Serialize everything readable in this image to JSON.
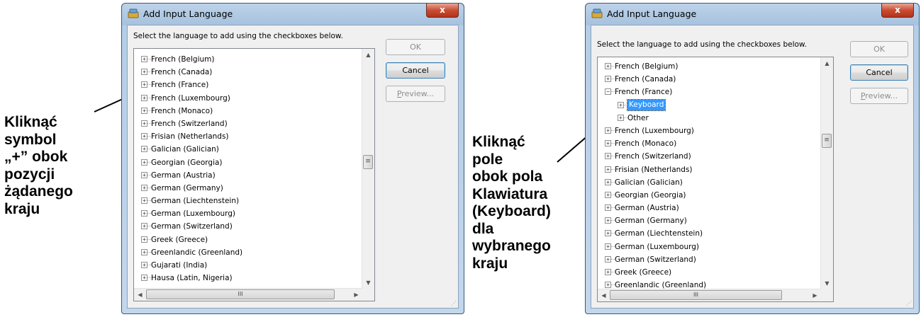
{
  "annotations": {
    "left": "Kliknąć\nsymbol\n„+” obok\npozycji\nżądanego\nkraju",
    "right": "Kliknąć\npole\nobok pola\nKlawiatura\n(Keyboard)\ndla\nwybranego\nkraju"
  },
  "dialog_left": {
    "title": "Add Input Language",
    "close_label": "x",
    "instruction": "Select the language to add using the checkboxes below.",
    "ok_label": "OK",
    "cancel_label": "Cancel",
    "preview_prefix": "P",
    "preview_rest": "review...",
    "items": [
      "French (Belgium)",
      "French (Canada)",
      "French (France)",
      "French (Luxembourg)",
      "French (Monaco)",
      "French (Switzerland)",
      "Frisian (Netherlands)",
      "Galician (Galician)",
      "Georgian (Georgia)",
      "German (Austria)",
      "German (Germany)",
      "German (Liechtenstein)",
      "German (Luxembourg)",
      "German (Switzerland)",
      "Greek (Greece)",
      "Greenlandic (Greenland)",
      "Gujarati (India)",
      "Hausa (Latin, Nigeria)"
    ],
    "hscroll_grip": "III",
    "vscroll_grip": "≡"
  },
  "dialog_right": {
    "title": "Add Input Language",
    "close_label": "x",
    "instruction": "Select the language to add using the checkboxes below.",
    "ok_label": "OK",
    "cancel_label": "Cancel",
    "preview_prefix": "P",
    "preview_rest": "review...",
    "items_before": [
      "French (Belgium)",
      "French (Canada)"
    ],
    "expanded_item": "French (France)",
    "child_selected": "Keyboard",
    "child_other": "Other",
    "items_after": [
      "French (Luxembourg)",
      "French (Monaco)",
      "French (Switzerland)",
      "Frisian (Netherlands)",
      "Galician (Galician)",
      "Georgian (Georgia)",
      "German (Austria)",
      "German (Germany)",
      "German (Liechtenstein)",
      "German (Luxembourg)",
      "German (Switzerland)",
      "Greek (Greece)",
      "Greenlandic (Greenland)"
    ],
    "hscroll_grip": "III",
    "vscroll_grip": "≡"
  }
}
